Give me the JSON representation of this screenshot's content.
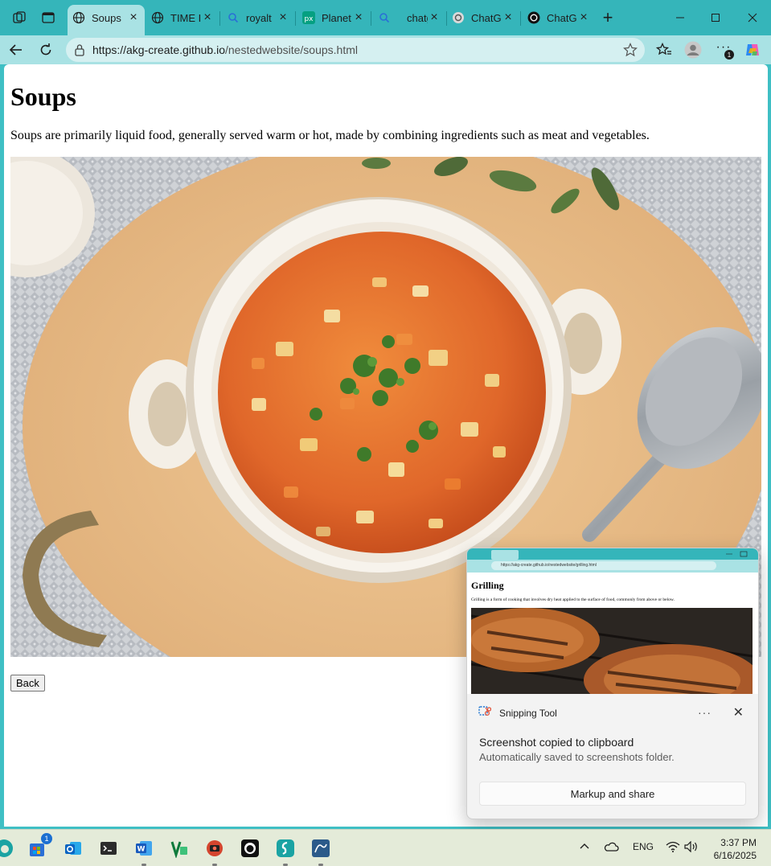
{
  "browser": {
    "tabs": [
      {
        "label": "Soups",
        "icon": "globe-icon",
        "active": true
      },
      {
        "label": "TIME I",
        "icon": "globe-icon"
      },
      {
        "label": "royalt",
        "icon": "search-icon"
      },
      {
        "label": "Planet",
        "icon": "px-icon"
      },
      {
        "label": "chatg",
        "icon": "search-icon"
      },
      {
        "label": "ChatG",
        "icon": "chatgpt-icon"
      },
      {
        "label": "ChatG",
        "icon": "openai-icon"
      }
    ],
    "new_tab_symbol": "+",
    "address": {
      "url_host": "https://akg-create.github.io",
      "url_path": "/nestedwebsite/soups.html"
    },
    "extension_badge": "1"
  },
  "page": {
    "heading": "Soups",
    "paragraph": "Soups are primarily liquid food, generally served warm or hot, made by combining ingredients such as meat and vegetables.",
    "image_alt": "Bowl of vegetable soup",
    "back_button": "Back"
  },
  "toast": {
    "app_name": "Snipping Tool",
    "more_symbol": "···",
    "close_symbol": "✕",
    "title": "Screenshot copied to clipboard",
    "subtitle": "Automatically saved to screenshots folder.",
    "action": "Markup and share",
    "thumbnail": {
      "url": "https://akg-create.github.io/nestedwebsite/grilling.html",
      "heading": "Grilling",
      "paragraph": "Grilling is a form of cooking that involves dry heat applied to the surface of food, commonly from above or below."
    }
  },
  "taskbar": {
    "store_badge": "1",
    "language": "ENG",
    "time": "3:37 PM",
    "date": "6/16/2025"
  },
  "colors": {
    "tabstrip": "#35b5ba",
    "toolbar": "#a9e2e4",
    "address_field": "#d5f0f1",
    "taskbar": "#e4ebd9"
  }
}
